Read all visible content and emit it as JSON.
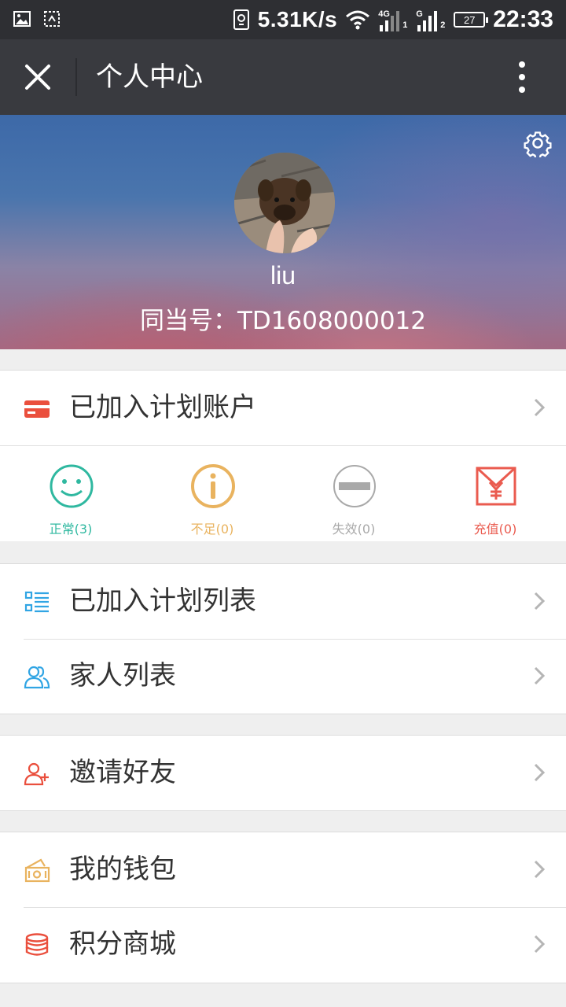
{
  "status_bar": {
    "net_speed": "5.31K/s",
    "net_4g": "4G",
    "net_g": "G",
    "sim1": "1",
    "sim2": "2",
    "battery": "27",
    "time": "22:33"
  },
  "toolbar": {
    "title": "个人中心"
  },
  "profile": {
    "username": "liu",
    "account_id": "同当号：TD1608000012"
  },
  "plan_account": {
    "label": "已加入计划账户"
  },
  "statuses": [
    {
      "label": "正常(3)",
      "color": "#2fb8a0"
    },
    {
      "label": "不足(0)",
      "color": "#e9b35f"
    },
    {
      "label": "失效(0)",
      "color": "#a9a9a9"
    },
    {
      "label": "充值(0)",
      "color": "#ea5b4f"
    }
  ],
  "menu": {
    "plan_list": "已加入计划列表",
    "family_list": "家人列表",
    "invite": "邀请好友",
    "wallet": "我的钱包",
    "points_mall": "积分商城"
  },
  "icons": {
    "close": "close-icon",
    "more": "more-vertical-icon",
    "settings": "gear-icon",
    "card": "card-icon",
    "list": "list-icon",
    "family": "family-icon",
    "invite": "add-user-icon",
    "wallet": "wallet-icon",
    "mall": "coins-icon"
  }
}
